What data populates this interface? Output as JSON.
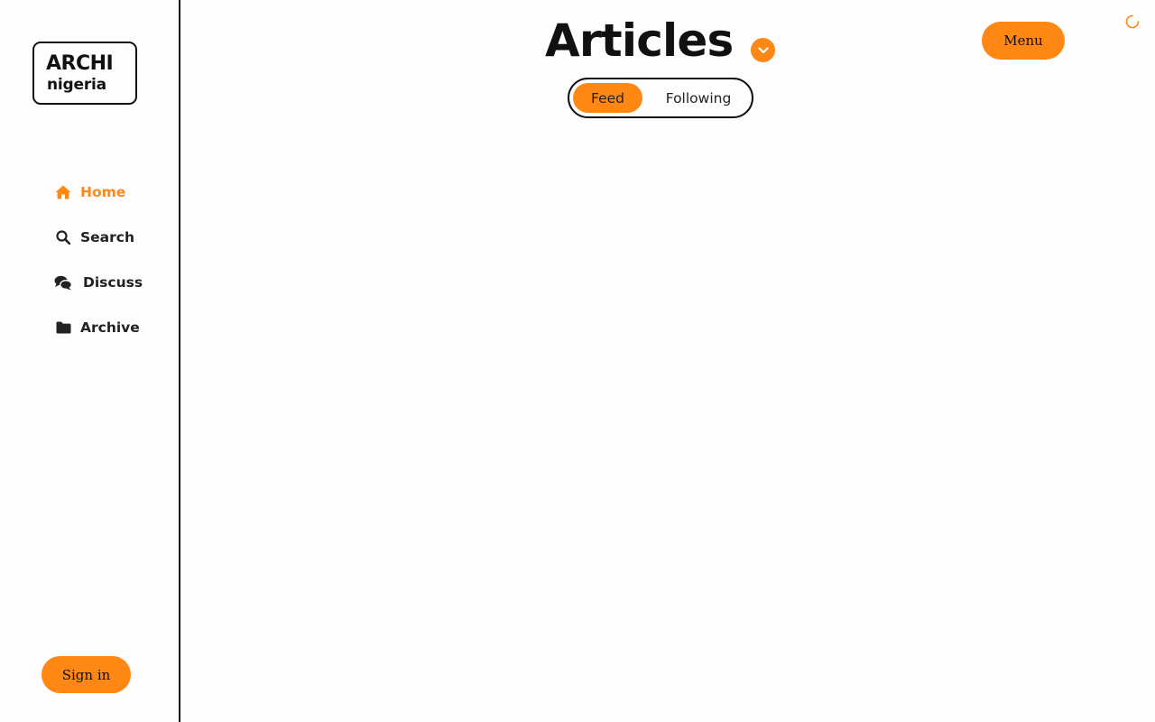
{
  "progress": {
    "fraction": 0.08
  },
  "sidebar": {
    "logo": {
      "line1": "ARCHI",
      "line2": "nigeria"
    },
    "items": [
      {
        "label": "Home",
        "icon": "home-icon",
        "active": true
      },
      {
        "label": "Search",
        "icon": "search-icon",
        "active": false
      },
      {
        "label": "Discuss",
        "icon": "comments-icon",
        "active": false
      },
      {
        "label": "Archive",
        "icon": "folder-icon",
        "active": false
      }
    ],
    "signin_label": "Sign in"
  },
  "header": {
    "title": "Articles",
    "menu_label": "Menu",
    "tabs": [
      {
        "label": "Feed",
        "active": true
      },
      {
        "label": "Following",
        "active": false
      }
    ]
  },
  "colors": {
    "accent": "#ff8714",
    "text": "#111111",
    "background": "#fdfdfd"
  }
}
